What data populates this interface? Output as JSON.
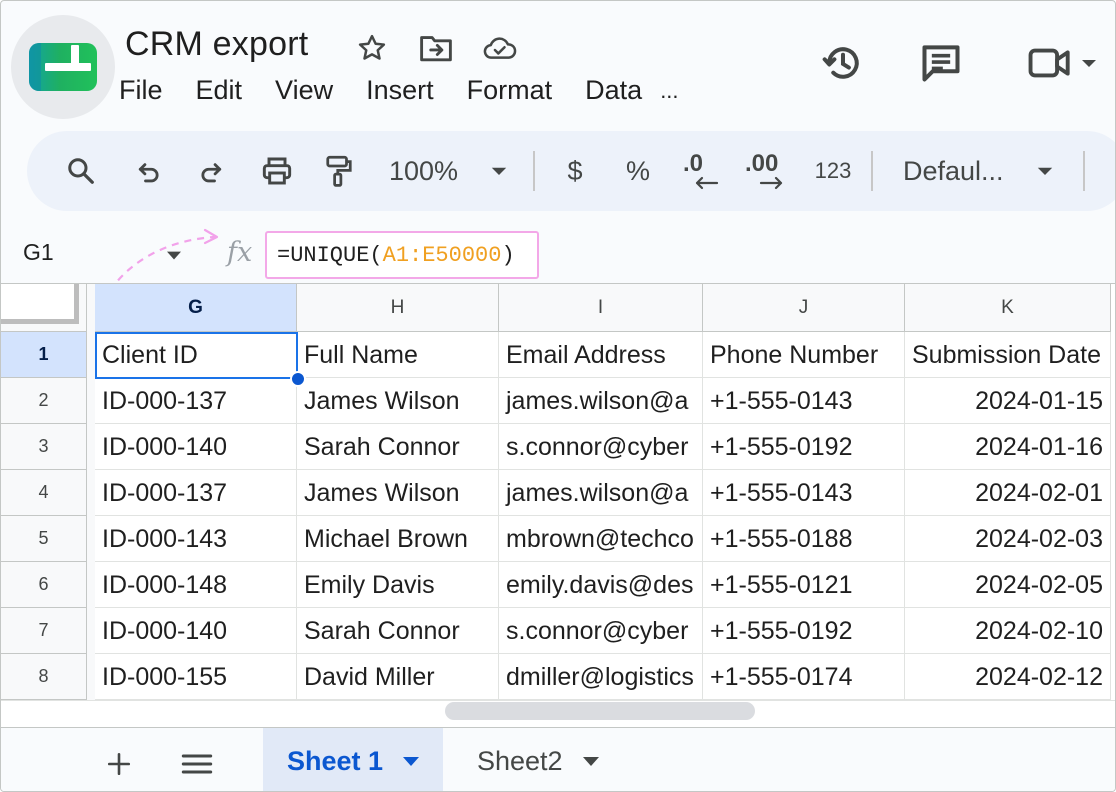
{
  "document": {
    "title": "CRM export"
  },
  "menubar": {
    "items": [
      "File",
      "Edit",
      "View",
      "Insert",
      "Format",
      "Data",
      "..."
    ]
  },
  "toolbar": {
    "zoom": "100%",
    "currency_label": "$",
    "percent_label": "%",
    "decrease_decimal_label": ".0",
    "increase_decimal_label": ".00",
    "number_format_label": "123",
    "font_label": "Defaul..."
  },
  "formula_bar": {
    "cell_ref": "G1",
    "fx_label": "fx",
    "formula_prefix": "=UNIQUE(",
    "formula_range": "A1:E50000",
    "formula_suffix": ")"
  },
  "grid": {
    "columns": [
      "G",
      "H",
      "I",
      "J",
      "K"
    ],
    "active_column": "G",
    "active_row": "1",
    "rows": [
      {
        "num": "1",
        "cells": [
          "Client ID",
          "Full Name",
          "Email Address",
          "Phone Number",
          "Submission Date"
        ]
      },
      {
        "num": "2",
        "cells": [
          "ID-000-137",
          "James Wilson",
          "james.wilson@a",
          "+1-555-0143",
          "2024-01-15"
        ]
      },
      {
        "num": "3",
        "cells": [
          "ID-000-140",
          "Sarah Connor",
          "s.connor@cyber",
          "+1-555-0192",
          "2024-01-16"
        ]
      },
      {
        "num": "4",
        "cells": [
          "ID-000-137",
          "James Wilson",
          "james.wilson@a",
          "+1-555-0143",
          "2024-02-01"
        ]
      },
      {
        "num": "5",
        "cells": [
          "ID-000-143",
          "Michael Brown",
          "mbrown@techco",
          "+1-555-0188",
          "2024-02-03"
        ]
      },
      {
        "num": "6",
        "cells": [
          "ID-000-148",
          "Emily Davis",
          "emily.davis@des",
          "+1-555-0121",
          "2024-02-05"
        ]
      },
      {
        "num": "7",
        "cells": [
          "ID-000-140",
          "Sarah Connor",
          "s.connor@cyber",
          "+1-555-0192",
          "2024-02-10"
        ]
      },
      {
        "num": "8",
        "cells": [
          "ID-000-155",
          "David Miller",
          "dmiller@logistics",
          "+1-555-0174",
          "2024-02-12"
        ]
      }
    ]
  },
  "sheets": {
    "tabs": [
      {
        "label": "Sheet 1",
        "active": true
      },
      {
        "label": "Sheet2",
        "active": false
      }
    ]
  },
  "colors": {
    "accent": "#0b57d0",
    "selection": "#1a73e8",
    "formula_range": "#f0a021",
    "formula_border": "#f3a8e8"
  },
  "icons": {
    "app": "sheets-logo-icon",
    "star": "star-icon",
    "move": "move-to-folder-icon",
    "cloud": "cloud-saved-icon",
    "history": "history-icon",
    "comments": "comment-icon",
    "meet": "video-call-icon",
    "search": "search-icon",
    "undo": "undo-icon",
    "redo": "redo-icon",
    "print": "print-icon",
    "paint_format": "paint-format-icon",
    "add_sheet": "plus-icon",
    "all_sheets": "menu-lines-icon"
  }
}
